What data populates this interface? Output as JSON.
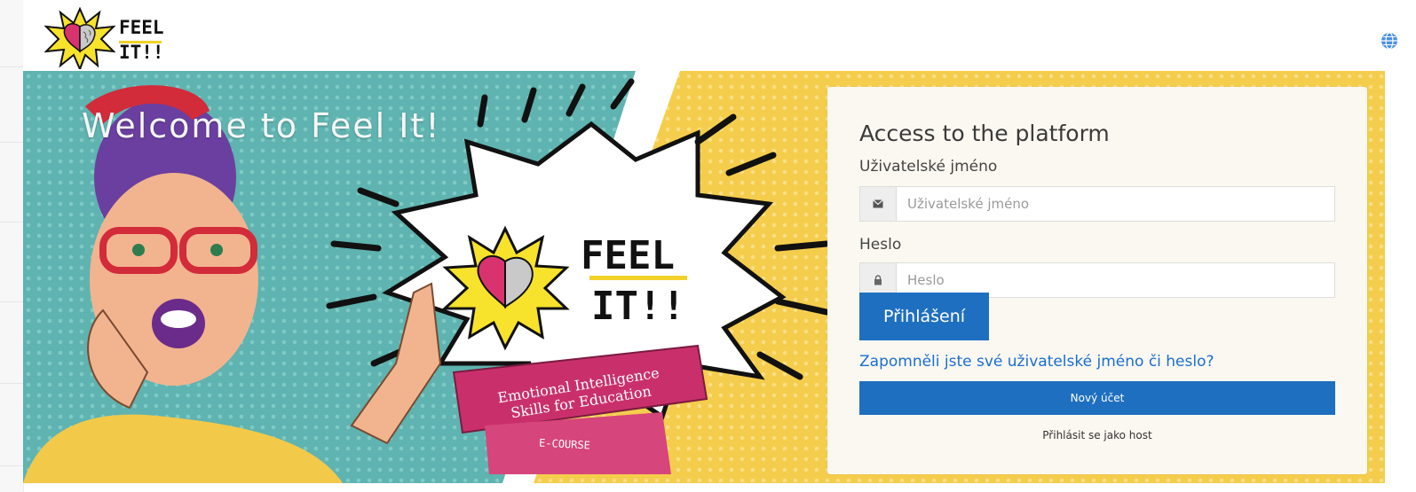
{
  "header": {
    "logo_line1": "FEEL",
    "logo_line2": "IT!!",
    "language_icon": "globe-icon"
  },
  "hero": {
    "welcome_text": "Welcome to Feel It!",
    "banner_logo_line1": "FEEL",
    "banner_logo_line2": "IT!!",
    "ribbon_line1": "Emotional Intelligence",
    "ribbon_line2": "Skills for Education",
    "ecourse_label": "E-COURSE"
  },
  "login": {
    "title": "Access to the platform",
    "username_label": "Uživatelské jméno",
    "username_placeholder": "Uživatelské jméno",
    "username_value": "",
    "username_icon": "envelope-icon",
    "password_label": "Heslo",
    "password_placeholder": "Heslo",
    "password_value": "",
    "password_icon": "lock-icon",
    "submit_label": "Přihlášení",
    "forgot_link": "Zapomněli jste své uživatelské jméno či heslo?",
    "new_account_label": "Nový účet",
    "guest_link": "Přihlásit se jako host"
  },
  "colors": {
    "primary": "#1f6fc1",
    "link": "#1a6ed0",
    "hero_yellow": "#f5cd4d",
    "hero_teal": "#5fb3b0",
    "ribbon_pink": "#c9306b"
  }
}
